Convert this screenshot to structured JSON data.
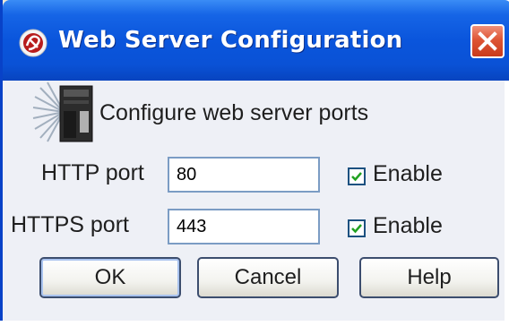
{
  "window": {
    "title": "Web Server Configuration"
  },
  "header": {
    "description": "Configure web server ports"
  },
  "http": {
    "label": "HTTP port",
    "value": "80",
    "enable_label": "Enable",
    "enabled": true
  },
  "https": {
    "label": "HTTPS port",
    "value": "443",
    "enable_label": "Enable",
    "enabled": true
  },
  "buttons": {
    "ok": "OK",
    "cancel": "Cancel",
    "help": "Help"
  },
  "colors": {
    "titlebar": "#0a55dc",
    "close": "#de5535",
    "dialog_bg": "#eef0f6",
    "checkmark": "#21a121"
  },
  "icons": {
    "title": "app-logo-icon",
    "close": "close-icon",
    "header": "server-icon",
    "checkbox": "checkmark-icon"
  }
}
